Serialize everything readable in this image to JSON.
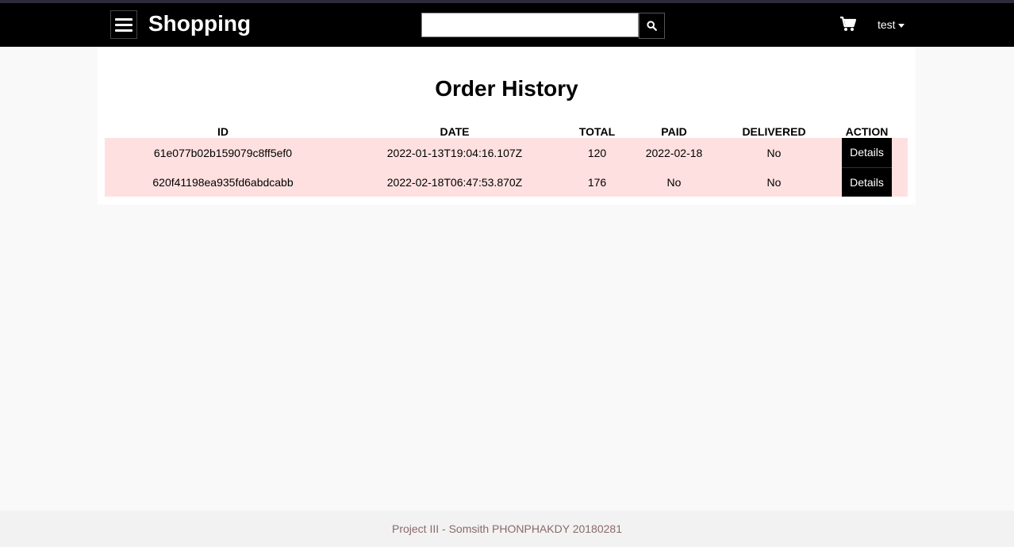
{
  "header": {
    "brand": "Shopping",
    "search": {
      "value": "",
      "placeholder": ""
    },
    "user_label": "test",
    "icons": {
      "menu": "hamburger-icon",
      "search": "search-icon",
      "cart": "cart-icon",
      "caret": "caret-down-icon"
    }
  },
  "main": {
    "title": "Order History",
    "columns": [
      "ID",
      "DATE",
      "TOTAL",
      "PAID",
      "DELIVERED",
      "ACTION"
    ],
    "orders": [
      {
        "id": "61e077b02b159079c8ff5ef0",
        "date": "2022-01-13T19:04:16.107Z",
        "total": "120",
        "paid": "2022-02-18",
        "delivered": "No",
        "action": "Details"
      },
      {
        "id": "620f41198ea935fd6abdcabb",
        "date": "2022-02-18T06:47:53.870Z",
        "total": "176",
        "paid": "No",
        "delivered": "No",
        "action": "Details"
      }
    ]
  },
  "footer": {
    "text": "Project III - Somsith PHONPHAKDY 20180281"
  },
  "colors": {
    "header_bg": "#000000",
    "row_bg": "#ffe0e0",
    "button_bg": "#000000",
    "footer_text": "#8b6a6a"
  }
}
